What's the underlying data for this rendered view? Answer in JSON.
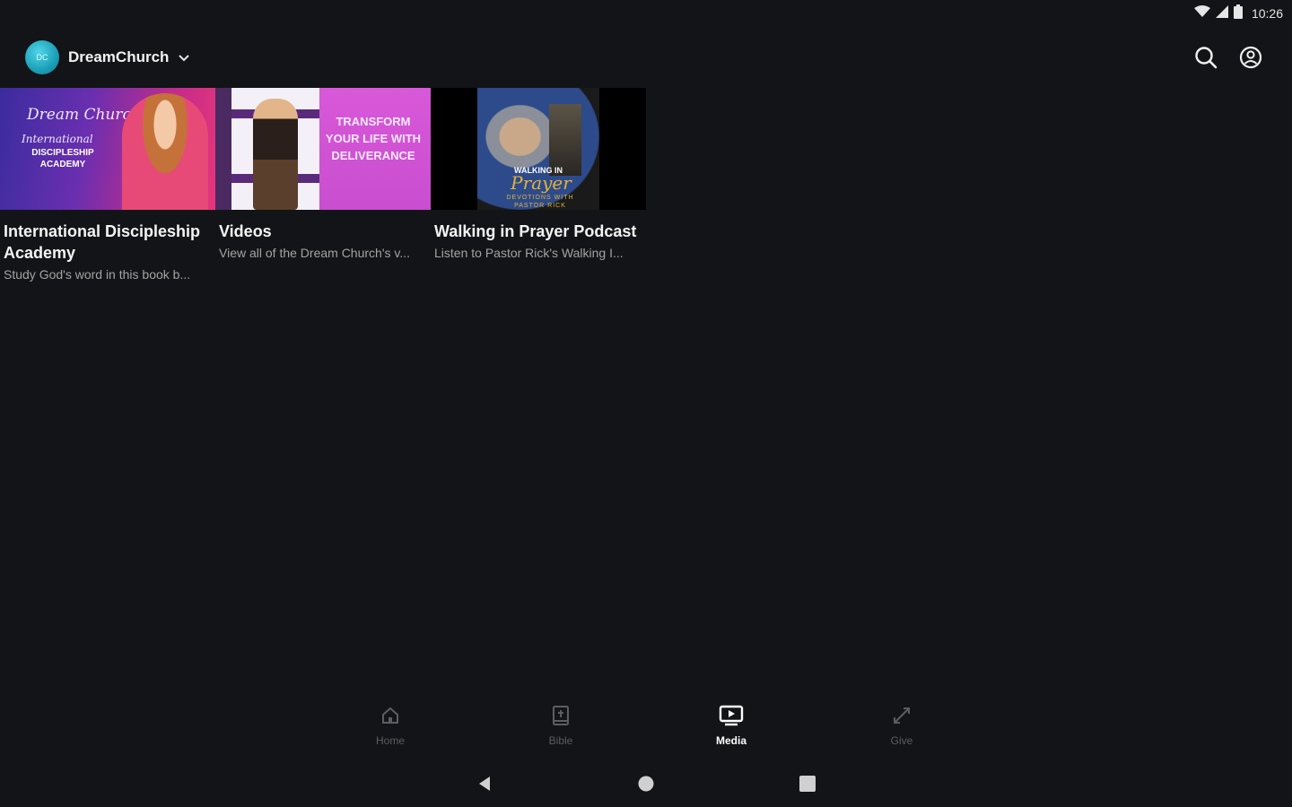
{
  "status_bar": {
    "time": "10:26",
    "icons": [
      "wifi-icon",
      "signal-icon",
      "battery-icon"
    ]
  },
  "app_bar": {
    "brand_name": "DreamChurch",
    "logo_text": "DC",
    "actions": [
      "search-icon",
      "account-icon"
    ]
  },
  "media_items": [
    {
      "title": "International Discipleship Academy",
      "description": "Study God's word in this book b...",
      "thumbnail": {
        "script_top": "Dream Church",
        "script_mid": "International",
        "caps": "DISCIPLESHIP ACADEMY"
      }
    },
    {
      "title": "Videos",
      "description": "View all of the Dream Church's v...",
      "thumbnail": {
        "text": "TRANSFORM YOUR LIFE WITH DELIVERANCE"
      }
    },
    {
      "title": "Walking in Prayer Podcast",
      "description": "Listen to Pastor Rick's Walking I...",
      "thumbnail": {
        "top": "WALKING IN",
        "script": "Prayer",
        "bottom": "DEVOTIONS WITH PASTOR RICK"
      }
    }
  ],
  "bottom_nav": {
    "items": [
      {
        "label": "Home",
        "icon": "home-icon",
        "active": false
      },
      {
        "label": "Bible",
        "icon": "bible-icon",
        "active": false
      },
      {
        "label": "Media",
        "icon": "media-icon",
        "active": true
      },
      {
        "label": "Give",
        "icon": "give-icon",
        "active": false
      }
    ]
  },
  "system_nav": [
    "back-icon",
    "home-circle-icon",
    "recents-icon"
  ],
  "colors": {
    "background": "#131417",
    "inactive_nav": "#5b5d63",
    "active_nav": "#ffffff",
    "brand_accent": "#1b9fb8"
  }
}
